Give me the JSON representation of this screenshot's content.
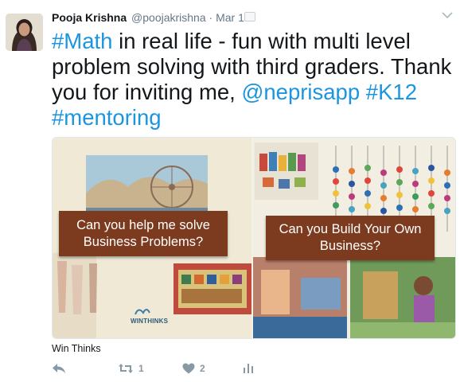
{
  "tweet": {
    "author_name": "Pooja Krishna",
    "author_handle": "@poojakrishna",
    "separator": "·",
    "date": "Mar 14",
    "text_parts": [
      {
        "text": "#Math",
        "link": true
      },
      {
        "text": " in real life - fun with multi level problem solving with third graders. Thank you for inviting me, ",
        "link": false
      },
      {
        "text": "@neprisapp",
        "link": true
      },
      {
        "text": " ",
        "link": false
      },
      {
        "text": "#K12",
        "link": true
      },
      {
        "text": " ",
        "link": false
      },
      {
        "text": "#mentoring",
        "link": true
      }
    ]
  },
  "card": {
    "left_banner_line1": "Can you help me solve",
    "left_banner_line2": "Business Problems?",
    "right_banner_line1": "Can you Build Your Own",
    "right_banner_line2": "Business?",
    "logo_text": "WINTHINKS",
    "source": "Win Thinks"
  },
  "actions": {
    "reply_icon": "reply-icon",
    "retweet_icon": "retweet-icon",
    "retweet_count": "1",
    "like_icon": "heart-icon",
    "like_count": "2",
    "analytics_icon": "analytics-icon"
  },
  "colors": {
    "link": "#1b95e0",
    "muted": "#8899a6",
    "banner": "#7c3b1f"
  }
}
